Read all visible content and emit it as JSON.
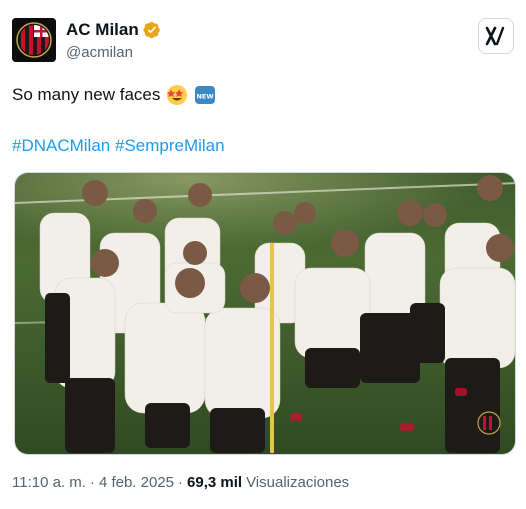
{
  "account": {
    "display_name": "AC Milan",
    "handle": "@acmilan"
  },
  "post": {
    "text": "So many new faces",
    "emojis": [
      "star-struck-emoji",
      "new-button-emoji"
    ],
    "new_badge": "NEW",
    "hashtags": [
      "#DNACMilan",
      "#SempreMilan"
    ]
  },
  "footer": {
    "time": "11:10 a. m.",
    "separator1": "·",
    "date": "4 feb. 2025",
    "separator2": "·",
    "views_count": "69,3 mil",
    "views_label": "Visualizaciones"
  },
  "colors": {
    "link": "#1d9bf0",
    "verified": "#e8a317",
    "muted": "#536471"
  },
  "icons": [
    "ac-milan-crest",
    "verified-badge-icon",
    "x-grok-icon"
  ]
}
